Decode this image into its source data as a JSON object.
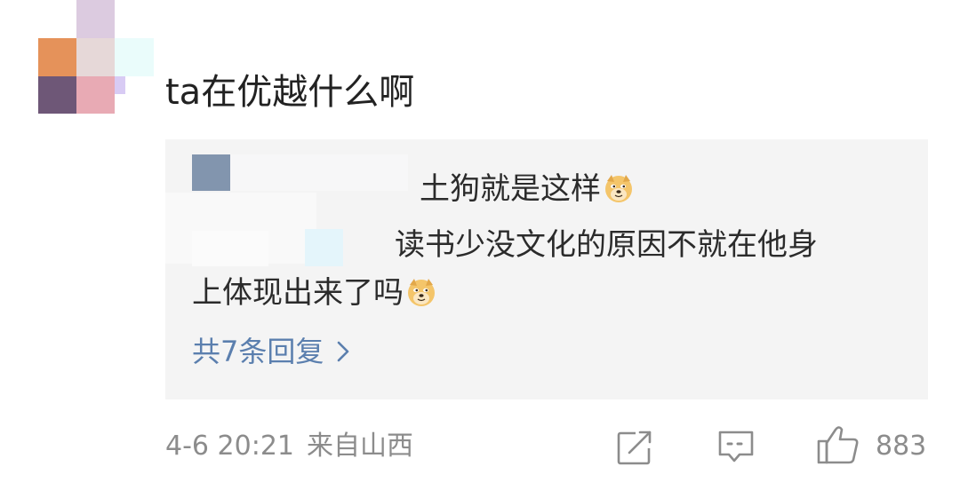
{
  "comment": {
    "text": "ta在优越什么啊"
  },
  "reply": {
    "line1": "土狗就是这样",
    "line2": "读书少没文化的原因不就在他身",
    "line3": "上体现出来了吗",
    "more_label": "共7条回复",
    "emoji": "doge-emoji"
  },
  "meta": {
    "time": "4-6 20:21",
    "source": "来自山西",
    "like_count": "883"
  },
  "icons": {
    "share": "share-icon",
    "comment": "comment-icon",
    "like": "thumbs-up-icon",
    "chevron": "chevron-right-icon"
  },
  "colors": {
    "link": "#5b7fae",
    "meta": "#8c8c8c",
    "reply_bg": "#f4f4f4",
    "text": "#222222"
  }
}
